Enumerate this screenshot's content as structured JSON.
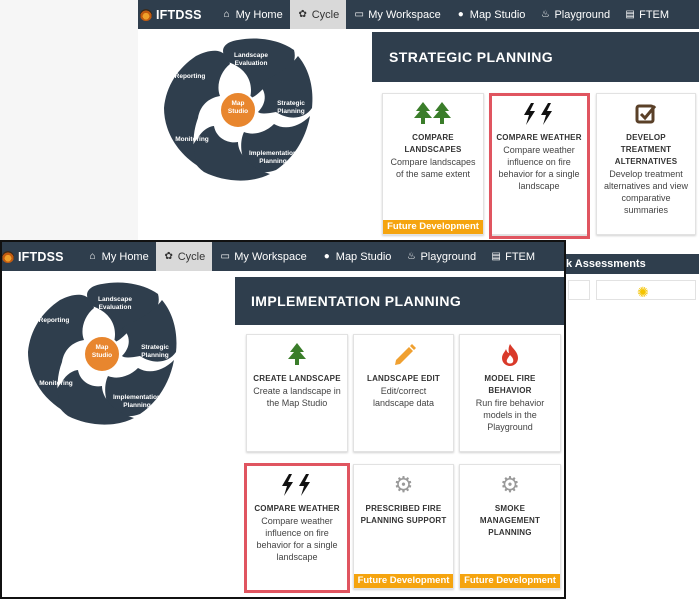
{
  "app": {
    "name": "IFTDSS"
  },
  "nav": {
    "items": [
      {
        "label": "My Home",
        "icon": "home-icon"
      },
      {
        "label": "Cycle",
        "icon": "gear-icon"
      },
      {
        "label": "My Workspace",
        "icon": "window-icon"
      },
      {
        "label": "Map Studio",
        "icon": "globe-icon"
      },
      {
        "label": "Playground",
        "icon": "fire-icon"
      },
      {
        "label": "FTEM",
        "icon": "document-icon"
      }
    ],
    "active": "Cycle"
  },
  "cycle": {
    "center": "Map Studio",
    "segments": [
      "Landscape Evaluation",
      "Strategic Planning",
      "Implementation Planning",
      "Monitoring",
      "Reporting"
    ],
    "colors": {
      "segment": "#2f3e4d",
      "center": "#e8862e"
    }
  },
  "back": {
    "title": "STRATEGIC PLANNING",
    "cards": [
      {
        "title": "COMPARE LANDSCAPES",
        "desc": "Compare landscapes of the same extent",
        "icon": "trees-icon",
        "future": "Future Development"
      },
      {
        "title": "COMPARE WEATHER",
        "desc": "Compare weather influence on fire behavior for a single landscape",
        "icon": "lightning-icon"
      },
      {
        "title": "DEVELOP TREATMENT ALTERNATIVES",
        "desc": "Develop treatment alternatives and view comparative summaries",
        "icon": "checkbox-icon"
      }
    ],
    "peek_title": "k Assessments",
    "peek_icon": "sun-icon"
  },
  "front": {
    "title": "IMPLEMENTATION PLANNING",
    "cards": [
      {
        "title": "CREATE LANDSCAPE",
        "desc": "Create a landscape in the Map Studio",
        "icon": "tree-icon"
      },
      {
        "title": "LANDSCAPE EDIT",
        "desc": "Edit/correct landscape data",
        "icon": "pencil-icon"
      },
      {
        "title": "MODEL FIRE BEHAVIOR",
        "desc": "Run fire behavior models in the Playground",
        "icon": "fire-icon"
      },
      {
        "title": "COMPARE WEATHER",
        "desc": "Compare weather influence on fire behavior for a single landscape",
        "icon": "lightning-icon"
      },
      {
        "title": "PRESCRIBED FIRE PLANNING SUPPORT",
        "desc": "",
        "icon": "gear-icon",
        "future": "Future Development"
      },
      {
        "title": "SMOKE MANAGEMENT PLANNING",
        "desc": "",
        "icon": "gear-icon",
        "future": "Future Development"
      }
    ]
  },
  "colors": {
    "navbar": "#2f3e4d",
    "future": "#f5a40f",
    "highlight": "#e05560",
    "tree": "#3a7d2a",
    "pencil": "#f0a030",
    "fire": "#d93a2a",
    "gear": "#9a9a9a",
    "check": "#5a4028"
  }
}
